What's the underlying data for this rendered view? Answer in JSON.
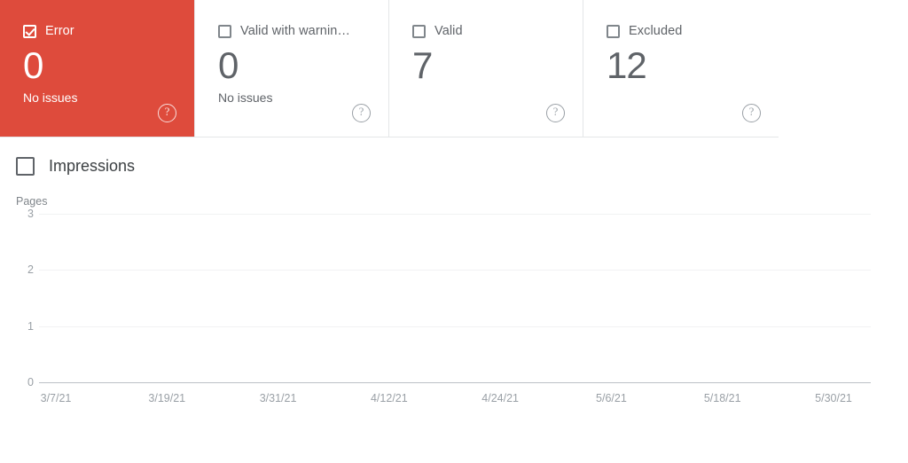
{
  "cards": [
    {
      "name": "error",
      "label": "Error",
      "value": "0",
      "sub": "No issues",
      "checked": true,
      "color": "#de4b3c",
      "help": "?"
    },
    {
      "name": "valid-with-warnings",
      "label": "Valid with warnin…",
      "value": "0",
      "sub": "No issues",
      "checked": false,
      "color": "#ffffff",
      "help": "?"
    },
    {
      "name": "valid",
      "label": "Valid",
      "value": "7",
      "sub": "",
      "checked": false,
      "color": "#ffffff",
      "help": "?"
    },
    {
      "name": "excluded",
      "label": "Excluded",
      "value": "12",
      "sub": "",
      "checked": false,
      "color": "#ffffff",
      "help": "?"
    }
  ],
  "impressions": {
    "label": "Impressions",
    "checked": false
  },
  "chart_data": {
    "type": "line",
    "title": "",
    "subtitle": "",
    "xlabel": "",
    "ylabel": "Pages",
    "ylim": [
      0,
      3
    ],
    "yticks": [
      "3",
      "2",
      "1",
      "0"
    ],
    "xticks": [
      "3/7/21",
      "3/19/21",
      "3/31/21",
      "4/12/21",
      "4/24/21",
      "5/6/21",
      "5/18/21",
      "5/30/21"
    ],
    "grid": true,
    "legend": "none",
    "series": [
      {
        "name": "Impressions",
        "values": []
      }
    ]
  }
}
